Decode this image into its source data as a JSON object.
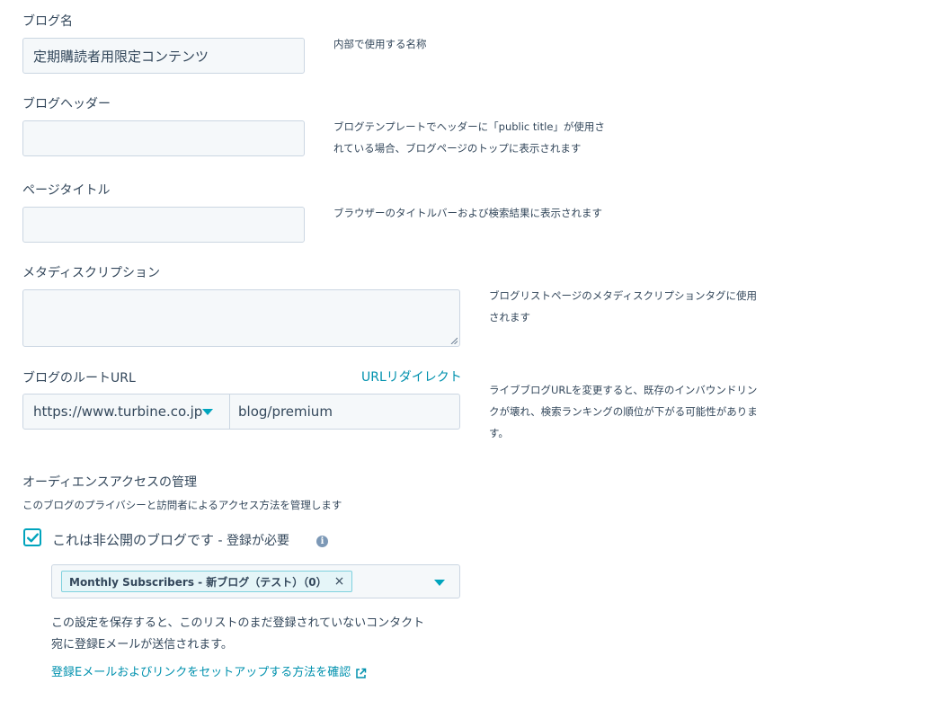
{
  "blog_name": {
    "label": "ブログ名",
    "value": "定期購読者用限定コンテンツ",
    "help": "内部で使用する名称"
  },
  "blog_header": {
    "label": "ブログヘッダー",
    "value": "",
    "help_line1": "ブログテンプレートでヘッダーに「public title」が使用さ",
    "help_line2": "れている場合、ブログページのトップに表示されます"
  },
  "page_title": {
    "label": "ページタイトル",
    "value": "",
    "help": "ブラウザーのタイトルバーおよび検索結果に表示されます"
  },
  "meta_description": {
    "label": "メタディスクリプション",
    "value": "",
    "help_line1": "ブログリストページのメタディスクリプションタグに使用",
    "help_line2": "されます"
  },
  "root_url": {
    "label": "ブログのルートURL",
    "redirect_link": "URLリダイレクト",
    "domain": "https://www.turbine.co.jp",
    "path": "blog/premium",
    "help_line1": "ライブブログURLを変更すると、既存のインバウンドリン",
    "help_line2": "クが壊れ、検索ランキングの順位が下がる可能性がありま",
    "help_line3": "す。"
  },
  "audience": {
    "title": "オーディエンスアクセスの管理",
    "subtitle": "このブログのプライバシーと訪問者によるアクセス方法を管理します",
    "checkbox_label": "これは非公開のブログです",
    "checkbox_suffix": " - 登録が必要",
    "checked": true,
    "selected_tag": "Monthly Subscribers - 新ブログ（テスト）（0）",
    "tag_remove": "×",
    "note_line1": "この設定を保存すると、このリストのまだ登録されていないコンタクト",
    "note_line2": "宛に登録Eメールが送信されます。",
    "setup_link": "登録Eメールおよびリンクをセットアップする方法を確認"
  },
  "colors": {
    "accent": "#00a4bd",
    "link": "#0091ae",
    "text": "#33475b",
    "input_bg": "#f5f8fa",
    "border": "#cbd6e2"
  },
  "icons": {
    "caret": "caret-down-icon",
    "check": "check-icon",
    "info": "info-icon",
    "external": "external-link-icon"
  }
}
